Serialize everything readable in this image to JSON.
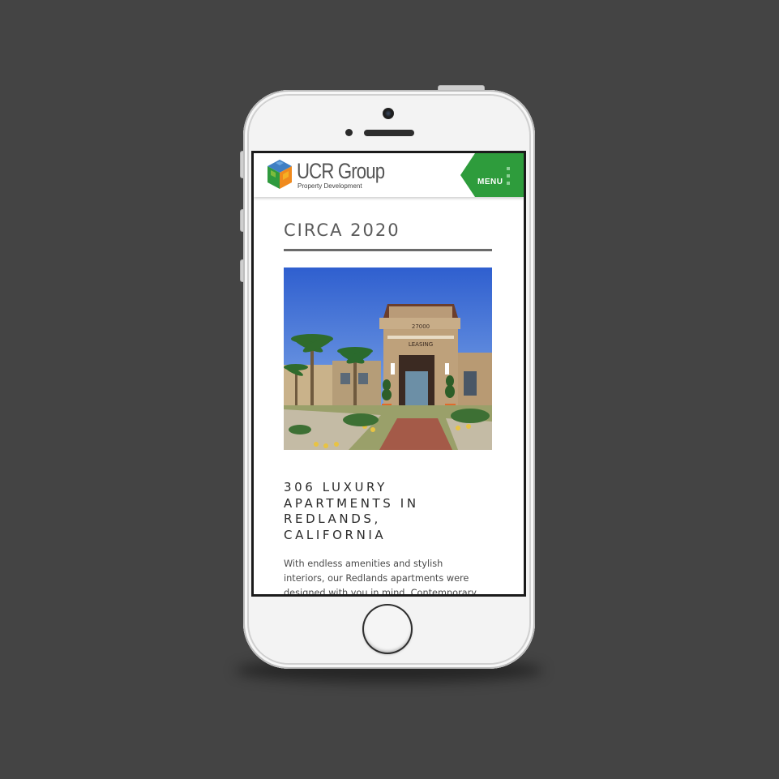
{
  "header": {
    "brand_name": "UCR Group",
    "brand_tagline": "Property Development",
    "menu_label": "MENU",
    "accent_color": "#2e9c3c"
  },
  "main": {
    "title": "CIRCA 2020",
    "photo": {
      "sign_number": "27000",
      "sign_text": "LEASING"
    },
    "subtitle": "306 LUXURY APARTMENTS IN REDLANDS, CALIFORNIA",
    "description": "With endless amenities and stylish interiors, our Redlands apartments were designed with you in mind. Contemporary styles turn"
  },
  "icons": [
    "ucr-cube-logo-icon",
    "menu-dots-icon"
  ]
}
